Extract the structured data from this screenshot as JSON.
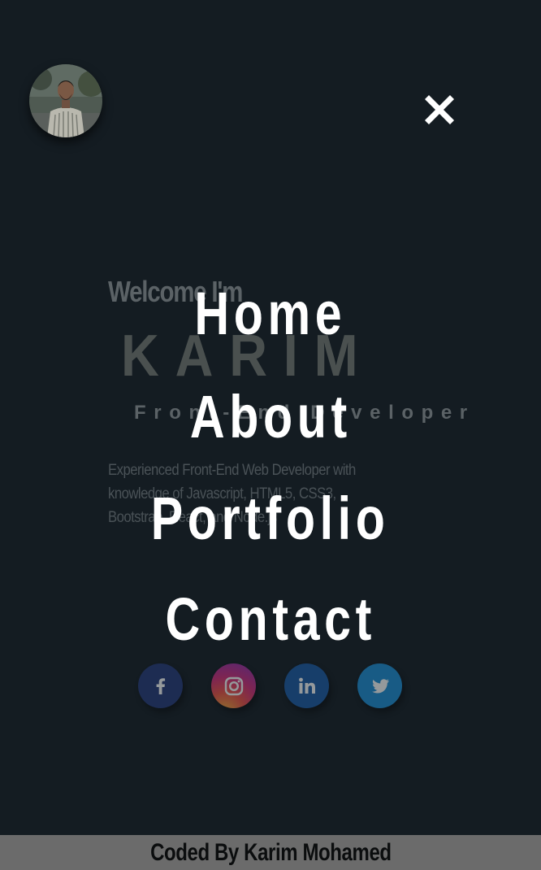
{
  "hero": {
    "welcome": "Welcome I'm",
    "name": "KARIM",
    "role": "Front-End Developer",
    "description": "Experienced Front-End Web Developer with knowledge of Javascript, HTML5, CSS3, Bootstrap, React, and Node.js"
  },
  "menu": {
    "items": [
      {
        "label": "Home"
      },
      {
        "label": "About"
      },
      {
        "label": "Portfolio"
      },
      {
        "label": "Contact"
      }
    ]
  },
  "socials": [
    {
      "icon": "facebook-icon",
      "color": "#263a7a"
    },
    {
      "icon": "instagram-icon",
      "color": "#d62e78"
    },
    {
      "icon": "linkedin-icon",
      "color": "#1b5aa6"
    },
    {
      "icon": "twitter-icon",
      "color": "#1c8fd6"
    }
  ],
  "footer": {
    "text": "Coded By Karim Mohamed"
  },
  "colors": {
    "background": "#141c22",
    "footer_bg": "#6b6b6b",
    "menu_text": "#ffffff"
  }
}
